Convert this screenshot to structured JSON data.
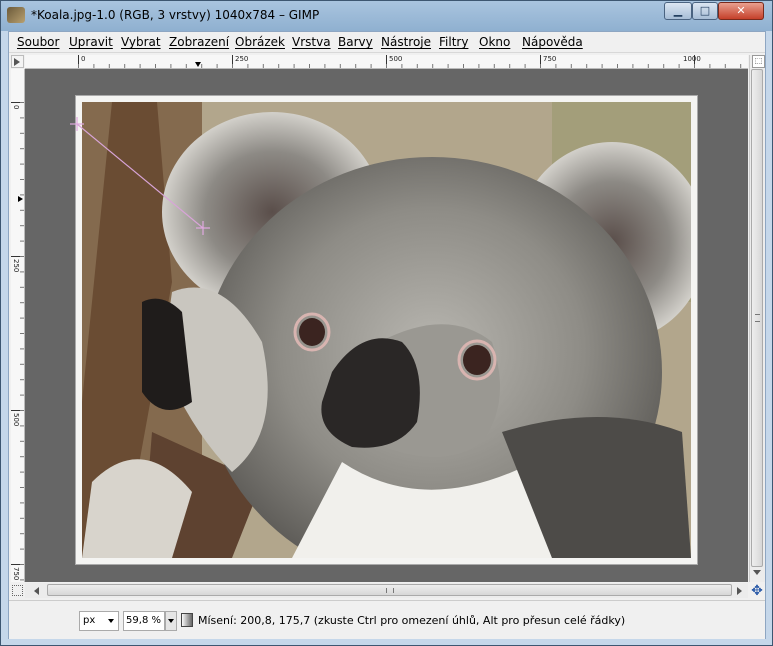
{
  "window": {
    "title": "*Koala.jpg-1.0 (RGB, 3 vrstvy) 1040x784 – GIMP",
    "minimize_glyph": "▁",
    "maximize_glyph": "□",
    "close_glyph": "✕"
  },
  "menu": [
    {
      "label": "Soubor"
    },
    {
      "label": "Upravit"
    },
    {
      "label": "Vybrat"
    },
    {
      "label": "Zobrazení"
    },
    {
      "label": "Obrázek"
    },
    {
      "label": "Vrstva"
    },
    {
      "label": "Barvy"
    },
    {
      "label": "Nástroje"
    },
    {
      "label": "Filtry"
    },
    {
      "label": "Okno"
    },
    {
      "label": "Nápověda"
    }
  ],
  "ruler": {
    "horizontal": [
      "0",
      "250",
      "500",
      "750",
      "1000"
    ],
    "vertical": [
      "0",
      "250",
      "500",
      "750"
    ]
  },
  "status": {
    "unit": "px",
    "zoom": "59,8 %",
    "message": "Mísení: 200,8, 175,7 (zkuste Ctrl pro omezení úhlů, Alt pro přesun celé řádky)"
  },
  "icons": {
    "app": "gimp-icon",
    "navigate": "navigate-icon",
    "quick_mask": "quick-mask-icon",
    "cancel": "cancel-icon",
    "zoom_to_fit": "zoom-fit-icon"
  }
}
